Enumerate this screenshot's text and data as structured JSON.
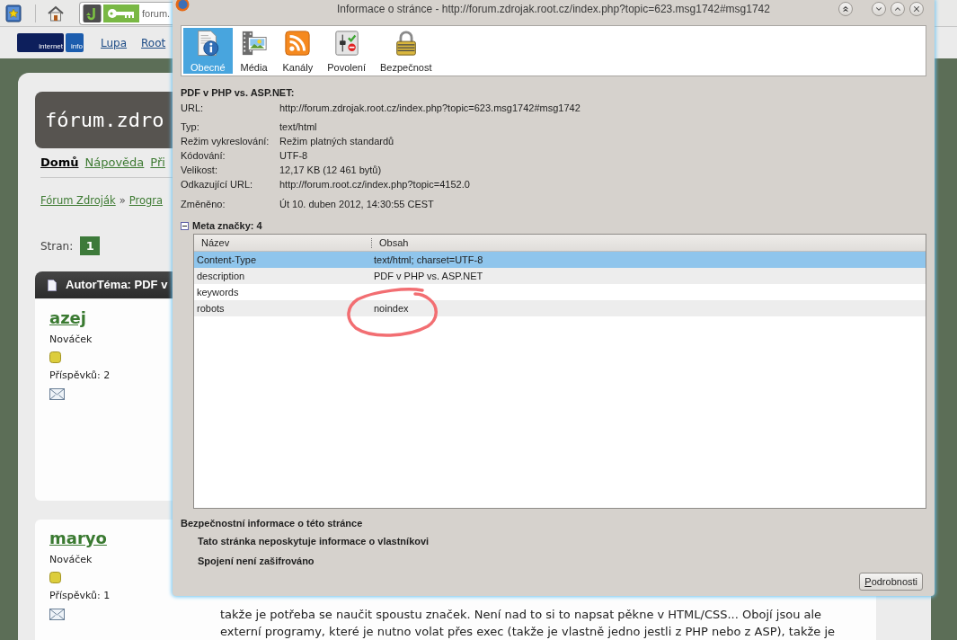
{
  "browser": {
    "address_field": {
      "value": "forum."
    },
    "bookmark_logo": [
      "internet",
      "info"
    ],
    "bookmark_links": [
      "Lupa",
      "Root"
    ]
  },
  "page": {
    "logo": "fórum.zdro",
    "nav": [
      {
        "label": "Domů",
        "selected": true
      },
      {
        "label": "Nápověda",
        "selected": false
      },
      {
        "label": "Při",
        "selected": false
      }
    ],
    "breadcrumb": {
      "items": [
        "Fórum Zdroják",
        "Progra"
      ],
      "separator": "»"
    },
    "pages_label": "Stran:",
    "pages": [
      {
        "label": "1",
        "selected": true
      }
    ],
    "topic_header": "AutorTéma: PDF v",
    "posts": [
      {
        "author": "azej",
        "rank": "Nováček",
        "post_count": "Příspěvků: 2"
      },
      {
        "author": "maryo",
        "rank": "Nováček",
        "post_count": "Příspěvků: 1",
        "text_lines": [
          "takže je potřeba se naučit spoustu značek. Není nad to si to napsat pěkne v HTML/CSS... Obojí jsou ale",
          "externí programy, které je nutno volat přes exec (takže je vlastně jedno jestli z PHP nebo z ASP), takže je"
        ]
      }
    ]
  },
  "dialog": {
    "title": "Informace o stránce - http://forum.zdrojak.root.cz/index.php?topic=623.msg1742#msg1742",
    "tabs": [
      {
        "label": "Obecné",
        "kind": "general",
        "selected": true
      },
      {
        "label": "Média",
        "kind": "media",
        "selected": false
      },
      {
        "label": "Kanály",
        "kind": "feeds",
        "selected": false
      },
      {
        "label": "Povolení",
        "kind": "permissions",
        "selected": false
      },
      {
        "label": "Bezpečnost",
        "kind": "security",
        "selected": false
      }
    ],
    "page_title": "PDF v PHP vs. ASP.NET:",
    "field_groups": [
      [
        {
          "label": "URL:",
          "value": "http://forum.zdrojak.root.cz/index.php?topic=623.msg1742#msg1742"
        }
      ],
      [
        {
          "label": "Typ:",
          "value": "text/html"
        },
        {
          "label": "Režim vykreslování:",
          "value": "Režim platných standardů"
        },
        {
          "label": "Kódování:",
          "value": "UTF-8"
        },
        {
          "label": "Velikost:",
          "value": "12,17 KB (12 461 bytů)"
        },
        {
          "label": "Odkazující URL:",
          "value": "http://forum.root.cz/index.php?topic=4152.0"
        }
      ],
      [
        {
          "label": "Změněno:",
          "value": "Út 10. duben 2012, 14:30:55 CEST"
        }
      ]
    ],
    "meta": {
      "heading": "Meta značky: 4",
      "expanded": true,
      "columns": [
        "Název",
        "Obsah"
      ],
      "rows": [
        {
          "name": "Content-Type",
          "content": "text/html; charset=UTF-8",
          "selected": true,
          "circled": false
        },
        {
          "name": "description",
          "content": "PDF v PHP vs. ASP.NET",
          "selected": false,
          "circled": false
        },
        {
          "name": "keywords",
          "selected": false,
          "circled": false
        },
        {
          "name": "robots",
          "content": "noindex",
          "selected": false,
          "circled": true
        }
      ]
    },
    "security": {
      "heading": "Bezpečnostní informace o této stránce",
      "lines": [
        "Tato stránka neposkytuje informace o vlastníkovi",
        "Spojení není zašifrováno"
      ],
      "button": "Podrobnosti"
    }
  }
}
